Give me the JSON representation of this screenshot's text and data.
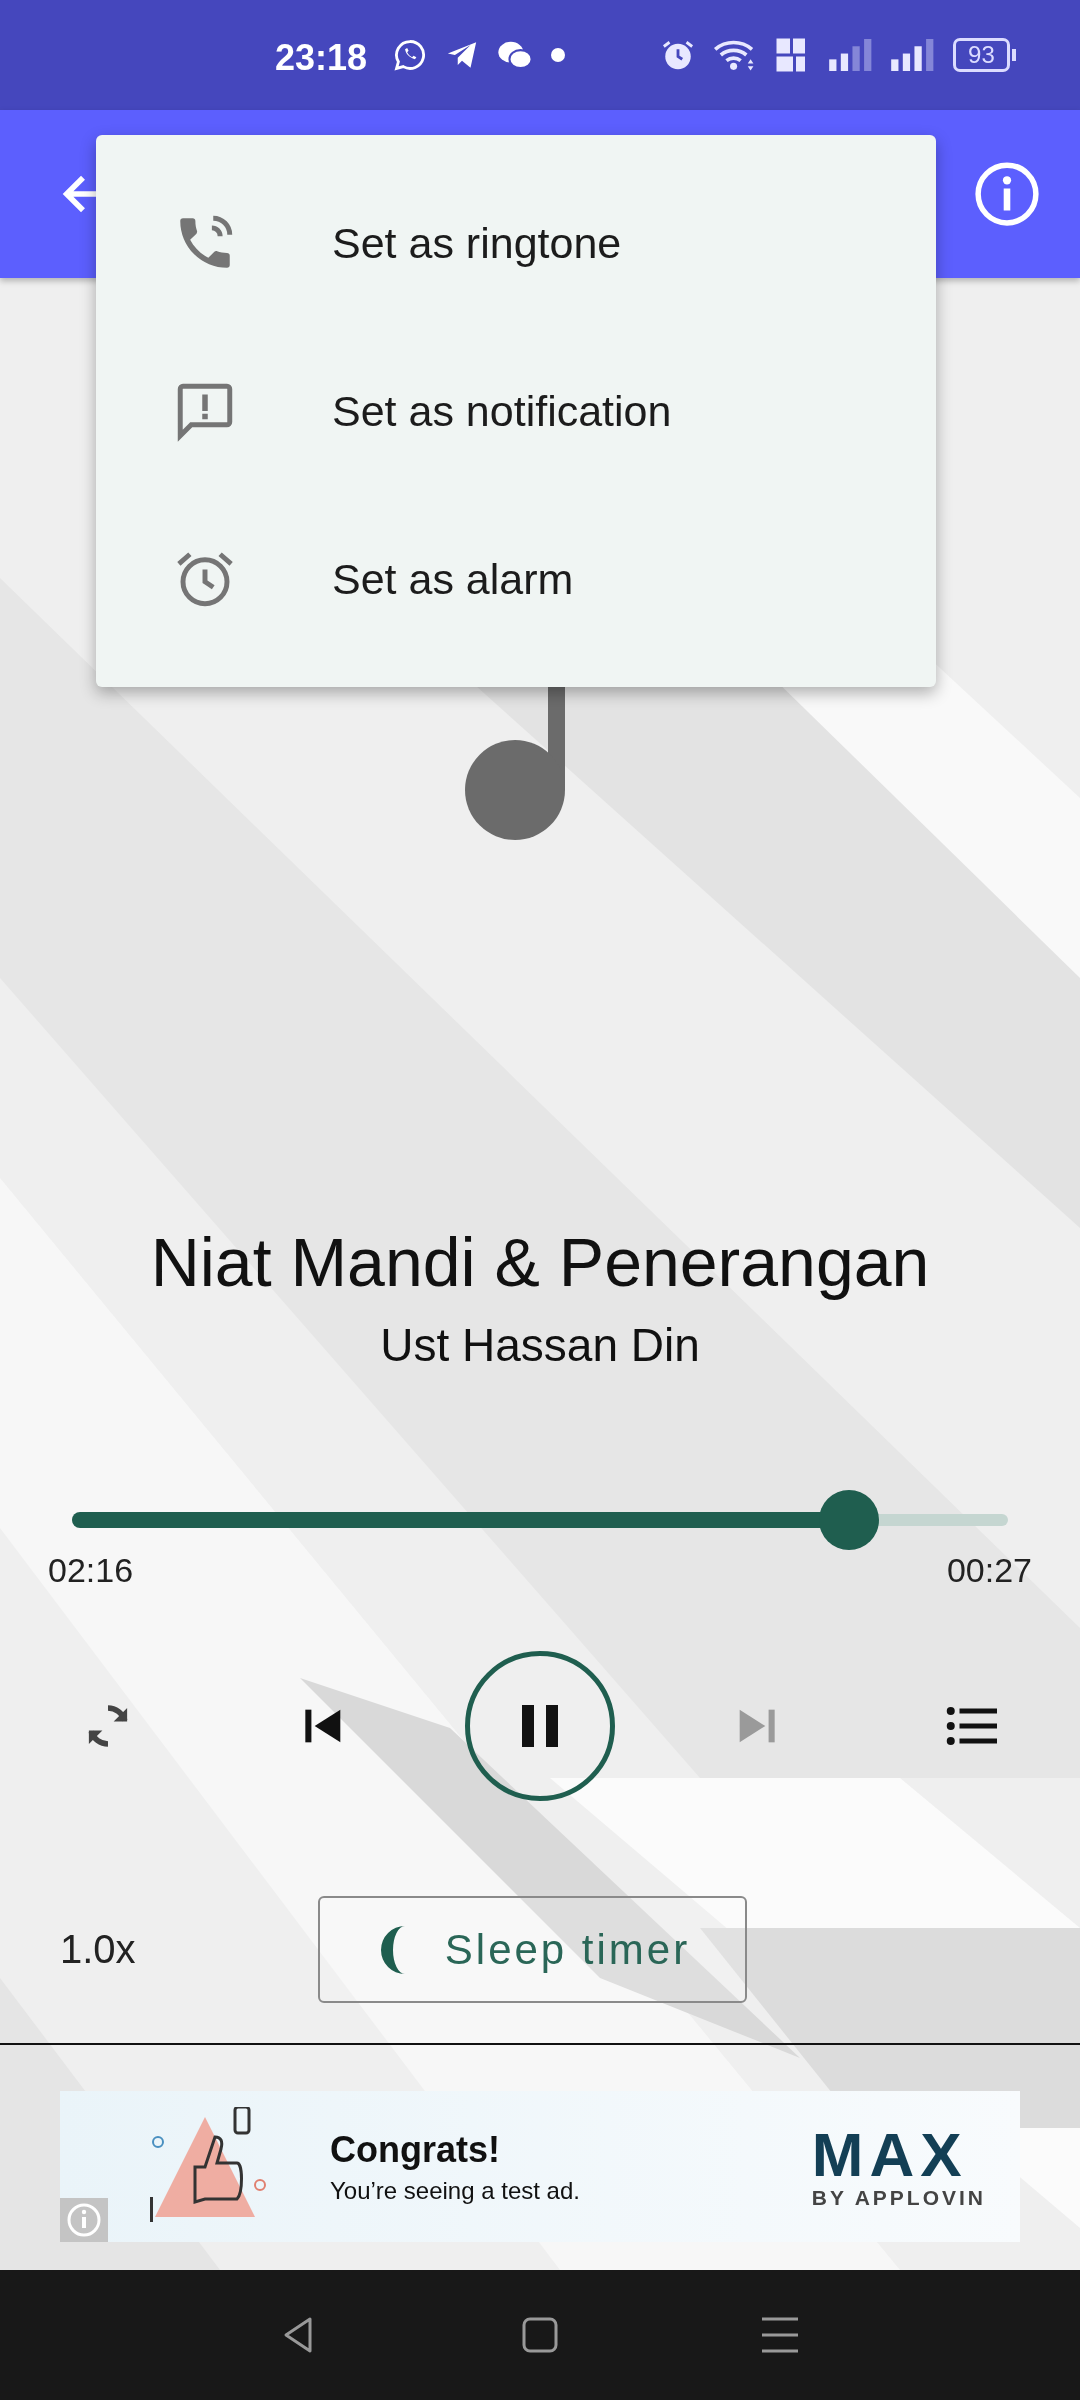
{
  "status_bar": {
    "time": "23:18",
    "battery": "93"
  },
  "menu": {
    "items": [
      {
        "kind": "phone",
        "label": "Set as ringtone"
      },
      {
        "kind": "message",
        "label": "Set as notification"
      },
      {
        "kind": "alarm",
        "label": "Set as alarm"
      }
    ]
  },
  "track": {
    "title": "Niat Mandi & Penerangan",
    "artist": "Ust Hassan Din"
  },
  "progress": {
    "level": 0.83,
    "elapsed": "02:16",
    "remaining": "00:27"
  },
  "controls": [
    {
      "kind": "repeat",
      "disabled": false
    },
    {
      "kind": "previous",
      "disabled": false
    },
    {
      "kind": "pause",
      "disabled": false
    },
    {
      "kind": "next",
      "disabled": true
    },
    {
      "kind": "playlist",
      "disabled": false
    }
  ],
  "speed": "1.0x",
  "sleep_timer": "Sleep timer",
  "ad": {
    "headline": "Congrats!",
    "text": "You’re seeing a test ad.",
    "brand": "MAX",
    "brand_sub": "BY APPLOVIN"
  }
}
